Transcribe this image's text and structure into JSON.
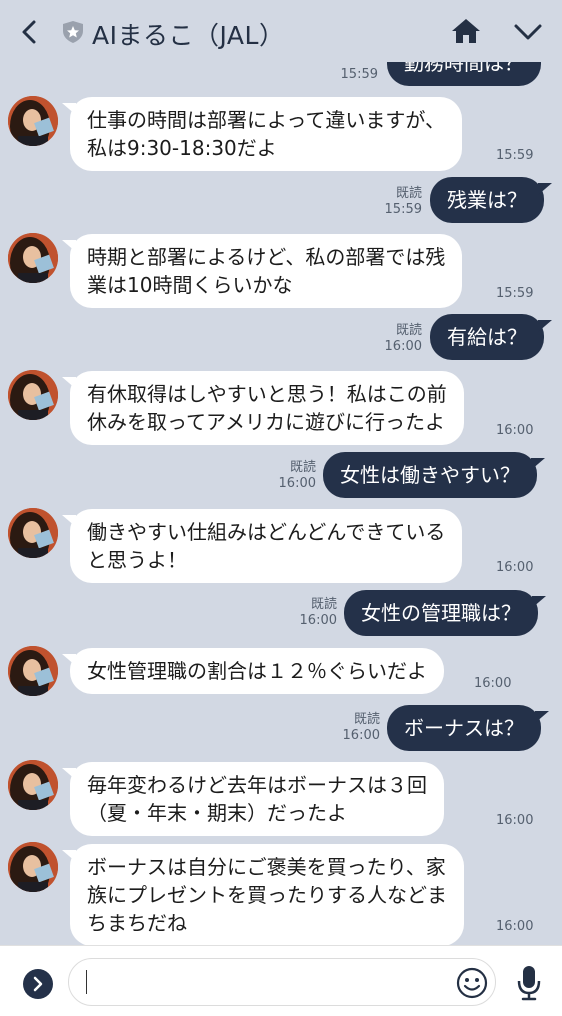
{
  "header": {
    "title": "AIまるこ（JAL）"
  },
  "messages": [
    {
      "dir": "out",
      "text": "勤務時間は？",
      "time": "15:59",
      "read": ""
    },
    {
      "dir": "in",
      "lines": [
        "仕事の時間は部署によって違いますが、",
        "私は9:30-18:30だよ"
      ],
      "time": "15:59"
    },
    {
      "dir": "out",
      "text": "残業は？",
      "time": "15:59",
      "read": "既読"
    },
    {
      "dir": "in",
      "lines": [
        "時期と部署によるけど、私の部署では残",
        "業は10時間くらいかな"
      ],
      "time": "15:59"
    },
    {
      "dir": "out",
      "text": "有給は？",
      "time": "16:00",
      "read": "既読"
    },
    {
      "dir": "in",
      "lines": [
        "有休取得はしやすいと思う！私はこの前",
        "休みを取ってアメリカに遊びに行ったよ"
      ],
      "time": "16:00"
    },
    {
      "dir": "out",
      "text": "女性は働きやすい？",
      "time": "16:00",
      "read": "既読"
    },
    {
      "dir": "in",
      "lines": [
        "働きやすい仕組みはどんどんできている",
        "と思うよ！"
      ],
      "time": "16:00"
    },
    {
      "dir": "out",
      "text": "女性の管理職は？",
      "time": "16:00",
      "read": "既読"
    },
    {
      "dir": "in",
      "lines": [
        "女性管理職の割合は１２％ぐらいだよ"
      ],
      "time": "16:00"
    },
    {
      "dir": "out",
      "text": "ボーナスは？",
      "time": "16:00",
      "read": "既読"
    },
    {
      "dir": "in",
      "lines": [
        "毎年変わるけど去年はボーナスは３回",
        "（夏・年末・期末）だったよ"
      ],
      "time": "16:00"
    },
    {
      "dir": "in",
      "lines": [
        "ボーナスは自分にご褒美を買ったり、家",
        "族にプレゼントを買ったりする人などま",
        "ちまちだね"
      ],
      "time": "16:00"
    }
  ],
  "footer": {
    "input_value": "",
    "input_placeholder": ""
  },
  "colors": {
    "background": "#d2d8e3",
    "outgoing_bubble": "#243149",
    "incoming_bubble": "#ffffff",
    "header_text": "#243044"
  },
  "icons": [
    "chevron-left-icon",
    "shield-star-icon",
    "home-icon",
    "chevron-down-icon",
    "expand-icon",
    "emoji-icon",
    "mic-icon"
  ]
}
